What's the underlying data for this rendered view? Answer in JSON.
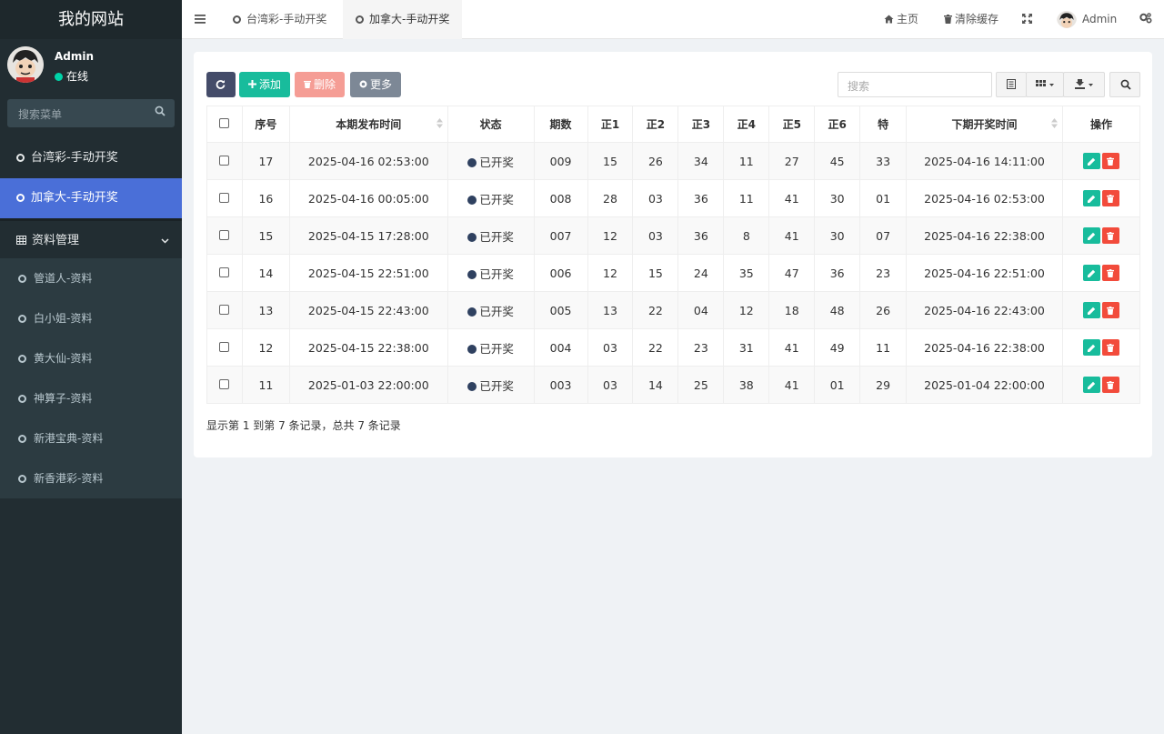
{
  "app": {
    "title": "我的网站"
  },
  "user": {
    "name": "Admin",
    "status": "在线"
  },
  "sidebar_search": {
    "placeholder": "搜索菜单"
  },
  "menu": {
    "items": [
      {
        "label": "台湾彩-手动开奖"
      },
      {
        "label": "加拿大-手动开奖"
      }
    ],
    "group": {
      "label": "资料管理"
    },
    "sub_items": [
      {
        "label": "管道人-资料"
      },
      {
        "label": "白小姐-资料"
      },
      {
        "label": "黄大仙-资料"
      },
      {
        "label": "神算子-资料"
      },
      {
        "label": "新港宝典-资料"
      },
      {
        "label": "新香港彩-资料"
      }
    ]
  },
  "topbar": {
    "tabs": [
      {
        "label": "台湾彩-手动开奖"
      },
      {
        "label": "加拿大-手动开奖"
      }
    ],
    "home": "主页",
    "clear_cache": "清除缓存",
    "user": "Admin"
  },
  "toolbar": {
    "add": "添加",
    "delete": "删除",
    "more": "更多",
    "search_placeholder": "搜索"
  },
  "table": {
    "headers": [
      "序号",
      "本期发布时间",
      "状态",
      "期数",
      "正1",
      "正2",
      "正3",
      "正4",
      "正5",
      "正6",
      "特",
      "下期开奖时间",
      "操作"
    ],
    "rows": [
      {
        "id": "17",
        "time": "2025-04-16 02:53:00",
        "status": "已开奖",
        "period": "009",
        "n1": "15",
        "n2": "26",
        "n3": "34",
        "n4": "11",
        "n5": "27",
        "n6": "45",
        "special": "33",
        "next": "2025-04-16 14:11:00"
      },
      {
        "id": "16",
        "time": "2025-04-16 00:05:00",
        "status": "已开奖",
        "period": "008",
        "n1": "28",
        "n2": "03",
        "n3": "36",
        "n4": "11",
        "n5": "41",
        "n6": "30",
        "special": "01",
        "next": "2025-04-16 02:53:00"
      },
      {
        "id": "15",
        "time": "2025-04-15 17:28:00",
        "status": "已开奖",
        "period": "007",
        "n1": "12",
        "n2": "03",
        "n3": "36",
        "n4": "8",
        "n5": "41",
        "n6": "30",
        "special": "07",
        "next": "2025-04-16 22:38:00"
      },
      {
        "id": "14",
        "time": "2025-04-15 22:51:00",
        "status": "已开奖",
        "period": "006",
        "n1": "12",
        "n2": "15",
        "n3": "24",
        "n4": "35",
        "n5": "47",
        "n6": "36",
        "special": "23",
        "next": "2025-04-16 22:51:00"
      },
      {
        "id": "13",
        "time": "2025-04-15 22:43:00",
        "status": "已开奖",
        "period": "005",
        "n1": "13",
        "n2": "22",
        "n3": "04",
        "n4": "12",
        "n5": "18",
        "n6": "48",
        "special": "26",
        "next": "2025-04-16 22:43:00"
      },
      {
        "id": "12",
        "time": "2025-04-15 22:38:00",
        "status": "已开奖",
        "period": "004",
        "n1": "03",
        "n2": "22",
        "n3": "23",
        "n4": "31",
        "n5": "41",
        "n6": "49",
        "special": "11",
        "next": "2025-04-16 22:38:00"
      },
      {
        "id": "11",
        "time": "2025-01-03 22:00:00",
        "status": "已开奖",
        "period": "003",
        "n1": "03",
        "n2": "14",
        "n3": "25",
        "n4": "38",
        "n5": "41",
        "n6": "01",
        "special": "29",
        "next": "2025-01-04 22:00:00"
      }
    ]
  },
  "footer": {
    "summary": "显示第 1 到第 7 条记录，总共 7 条记录"
  },
  "colors": {
    "sidebar": "#222d32",
    "active": "#4a6fd8",
    "add": "#18bc9c",
    "delete": "#f24b3b",
    "status_dot": "#2f4160"
  }
}
